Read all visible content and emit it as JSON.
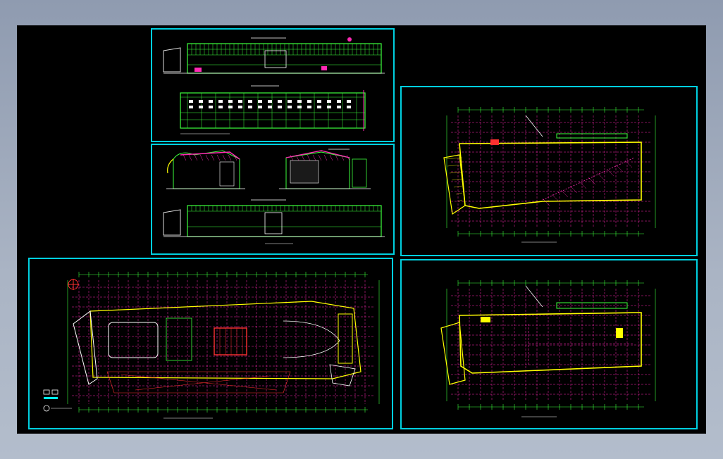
{
  "window": {
    "background": "#9aa6b8"
  },
  "canvas": {
    "background": "#000000"
  },
  "colors": {
    "frame": "#00d0e0",
    "grid": "#ff2ab4",
    "axis": "#3cff3c",
    "wall": "#ffff00",
    "wall_alt": "#ff2ab4",
    "dim": "#ffffff",
    "detail": "#ff3030",
    "cyan": "#00ffff"
  },
  "sheets": [
    {
      "id": "elevations-1",
      "kind": "elevation",
      "caption": ""
    },
    {
      "id": "sections-elevation",
      "kind": "section",
      "caption": ""
    },
    {
      "id": "plan-upper",
      "kind": "plan",
      "caption": ""
    },
    {
      "id": "plan-ground",
      "kind": "plan",
      "caption": ""
    },
    {
      "id": "plan-roof",
      "kind": "plan",
      "caption": ""
    }
  ],
  "icons": {
    "north_arrow": "north-arrow-icon",
    "legend": "legend-symbol-icon"
  }
}
